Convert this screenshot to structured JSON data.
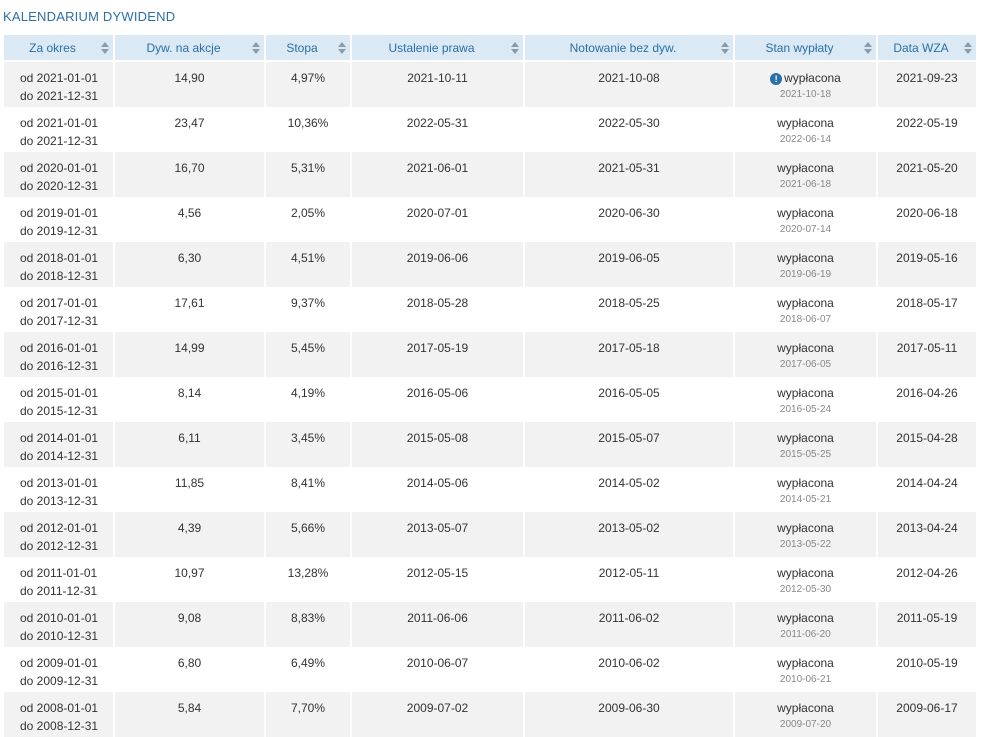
{
  "title": "KALENDARIUM DYWIDEND",
  "columns": [
    "Za okres",
    "Dyw. na akcje",
    "Stopa",
    "Ustalenie prawa",
    "Notowanie bez dyw.",
    "Stan wypłaty",
    "Data WZA"
  ],
  "rows": [
    {
      "from": "od 2021-01-01",
      "to": "do 2021-12-31",
      "dividend": "14,90",
      "rate": "4,97%",
      "record_date": "2021-10-11",
      "ex_date": "2021-10-08",
      "status": "wypłacona",
      "status_icon": "info-icon",
      "pay_date": "2021-10-18",
      "agm": "2021-09-23"
    },
    {
      "from": "od 2021-01-01",
      "to": "do 2021-12-31",
      "dividend": "23,47",
      "rate": "10,36%",
      "record_date": "2022-05-31",
      "ex_date": "2022-05-30",
      "status": "wypłacona",
      "pay_date": "2022-06-14",
      "agm": "2022-05-19"
    },
    {
      "from": "od 2020-01-01",
      "to": "do 2020-12-31",
      "dividend": "16,70",
      "rate": "5,31%",
      "record_date": "2021-06-01",
      "ex_date": "2021-05-31",
      "status": "wypłacona",
      "pay_date": "2021-06-18",
      "agm": "2021-05-20"
    },
    {
      "from": "od 2019-01-01",
      "to": "do 2019-12-31",
      "dividend": "4,56",
      "rate": "2,05%",
      "record_date": "2020-07-01",
      "ex_date": "2020-06-30",
      "status": "wypłacona",
      "pay_date": "2020-07-14",
      "agm": "2020-06-18"
    },
    {
      "from": "od 2018-01-01",
      "to": "do 2018-12-31",
      "dividend": "6,30",
      "rate": "4,51%",
      "record_date": "2019-06-06",
      "ex_date": "2019-06-05",
      "status": "wypłacona",
      "pay_date": "2019-06-19",
      "agm": "2019-05-16"
    },
    {
      "from": "od 2017-01-01",
      "to": "do 2017-12-31",
      "dividend": "17,61",
      "rate": "9,37%",
      "record_date": "2018-05-28",
      "ex_date": "2018-05-25",
      "status": "wypłacona",
      "pay_date": "2018-06-07",
      "agm": "2018-05-17"
    },
    {
      "from": "od 2016-01-01",
      "to": "do 2016-12-31",
      "dividend": "14,99",
      "rate": "5,45%",
      "record_date": "2017-05-19",
      "ex_date": "2017-05-18",
      "status": "wypłacona",
      "pay_date": "2017-06-05",
      "agm": "2017-05-11"
    },
    {
      "from": "od 2015-01-01",
      "to": "do 2015-12-31",
      "dividend": "8,14",
      "rate": "4,19%",
      "record_date": "2016-05-06",
      "ex_date": "2016-05-05",
      "status": "wypłacona",
      "pay_date": "2016-05-24",
      "agm": "2016-04-26"
    },
    {
      "from": "od 2014-01-01",
      "to": "do 2014-12-31",
      "dividend": "6,11",
      "rate": "3,45%",
      "record_date": "2015-05-08",
      "ex_date": "2015-05-07",
      "status": "wypłacona",
      "pay_date": "2015-05-25",
      "agm": "2015-04-28"
    },
    {
      "from": "od 2013-01-01",
      "to": "do 2013-12-31",
      "dividend": "11,85",
      "rate": "8,41%",
      "record_date": "2014-05-06",
      "ex_date": "2014-05-02",
      "status": "wypłacona",
      "pay_date": "2014-05-21",
      "agm": "2014-04-24"
    },
    {
      "from": "od 2012-01-01",
      "to": "do 2012-12-31",
      "dividend": "4,39",
      "rate": "5,66%",
      "record_date": "2013-05-07",
      "ex_date": "2013-05-02",
      "status": "wypłacona",
      "pay_date": "2013-05-22",
      "agm": "2013-04-24"
    },
    {
      "from": "od 2011-01-01",
      "to": "do 2011-12-31",
      "dividend": "10,97",
      "rate": "13,28%",
      "record_date": "2012-05-15",
      "ex_date": "2012-05-11",
      "status": "wypłacona",
      "pay_date": "2012-05-30",
      "agm": "2012-04-26"
    },
    {
      "from": "od 2010-01-01",
      "to": "do 2010-12-31",
      "dividend": "9,08",
      "rate": "8,83%",
      "record_date": "2011-06-06",
      "ex_date": "2011-06-02",
      "status": "wypłacona",
      "pay_date": "2011-06-20",
      "agm": "2011-05-19"
    },
    {
      "from": "od 2009-01-01",
      "to": "do 2009-12-31",
      "dividend": "6,80",
      "rate": "6,49%",
      "record_date": "2010-06-07",
      "ex_date": "2010-06-02",
      "status": "wypłacona",
      "pay_date": "2010-06-21",
      "agm": "2010-05-19"
    },
    {
      "from": "od 2008-01-01",
      "to": "do 2008-12-31",
      "dividend": "5,84",
      "rate": "7,70%",
      "record_date": "2009-07-02",
      "ex_date": "2009-06-30",
      "status": "wypłacona",
      "pay_date": "2009-07-20",
      "agm": "2009-06-17"
    }
  ],
  "colors": {
    "accent": "#2a6fa8",
    "header_bg": "#dbe9f5",
    "row_alt": "#f2f2f2"
  }
}
